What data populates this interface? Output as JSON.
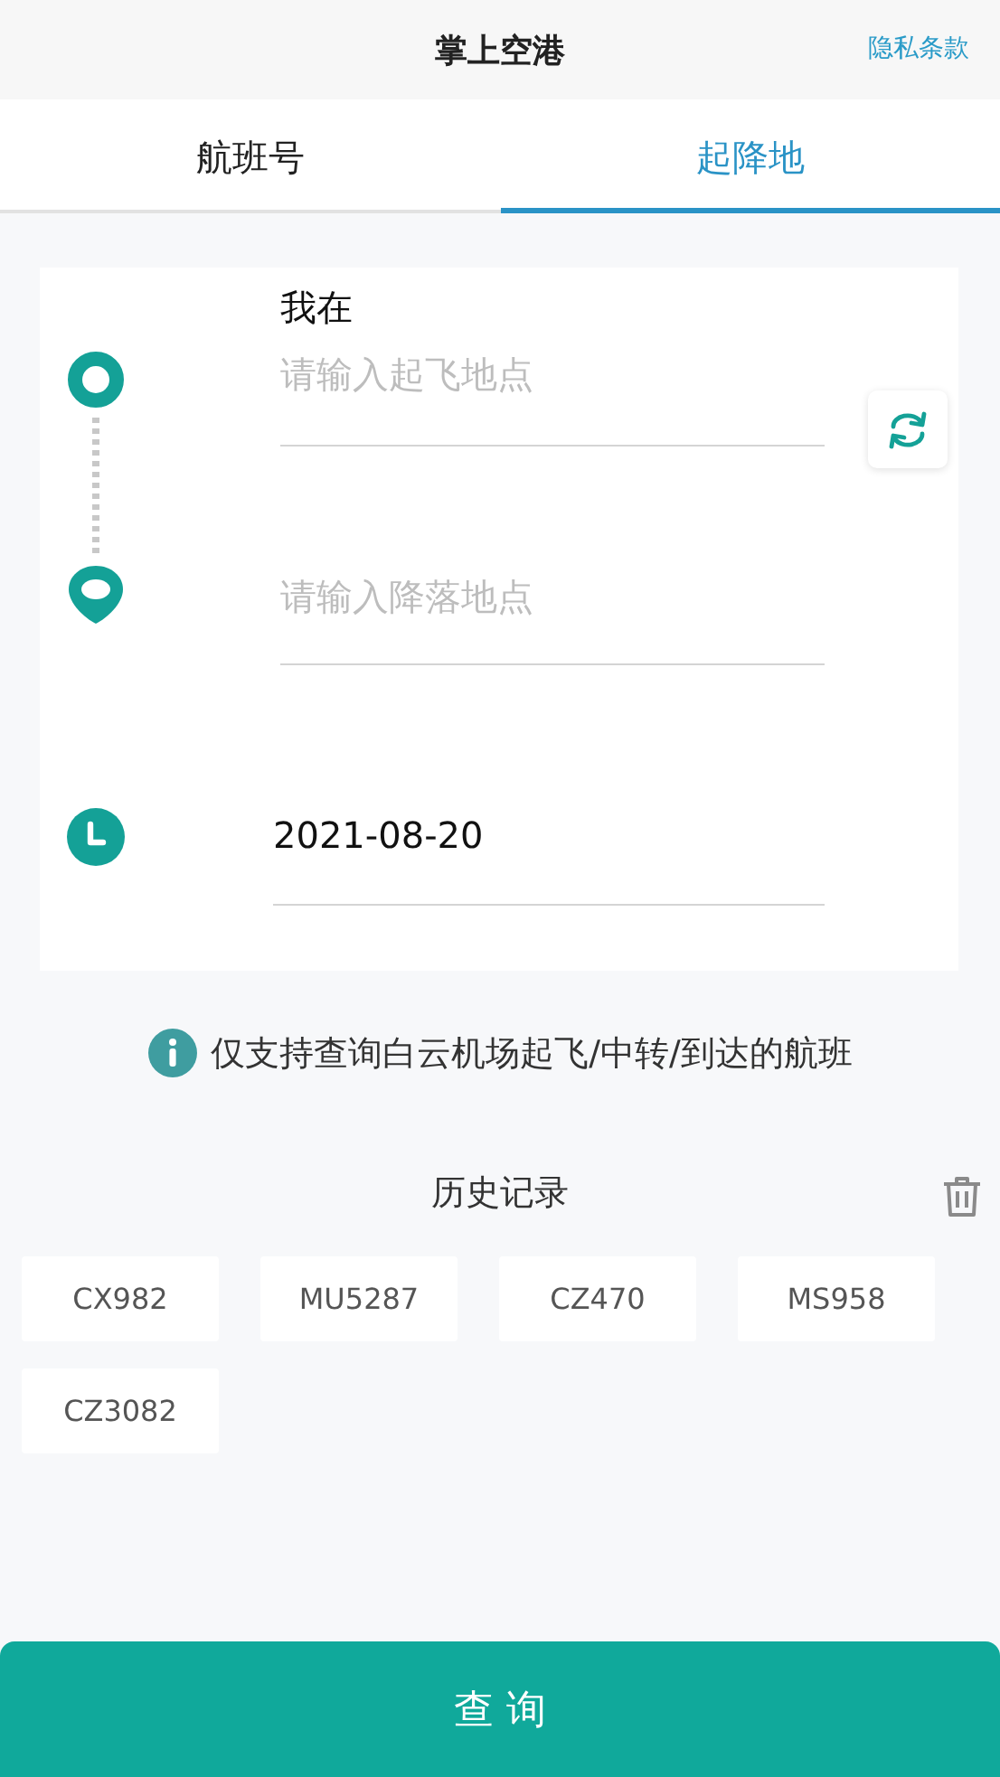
{
  "header": {
    "title": "掌上空港",
    "privacy_link": "隐私条款"
  },
  "tabs": [
    {
      "label": "航班号",
      "selected": false
    },
    {
      "label": "起降地",
      "selected": true
    }
  ],
  "route": {
    "location_label": "我在",
    "departure": {
      "placeholder": "请输入起飞地点"
    },
    "arrival": {
      "placeholder": "请输入降落地点"
    },
    "date": "2021-08-20"
  },
  "notice": "仅支持查询白云机场起飞/中转/到达的航班",
  "history": {
    "title": "历史记录",
    "items": [
      "CX982",
      "MU5287",
      "CZ470",
      "MS958",
      "CZ3082"
    ]
  },
  "query_button": "查 询"
}
